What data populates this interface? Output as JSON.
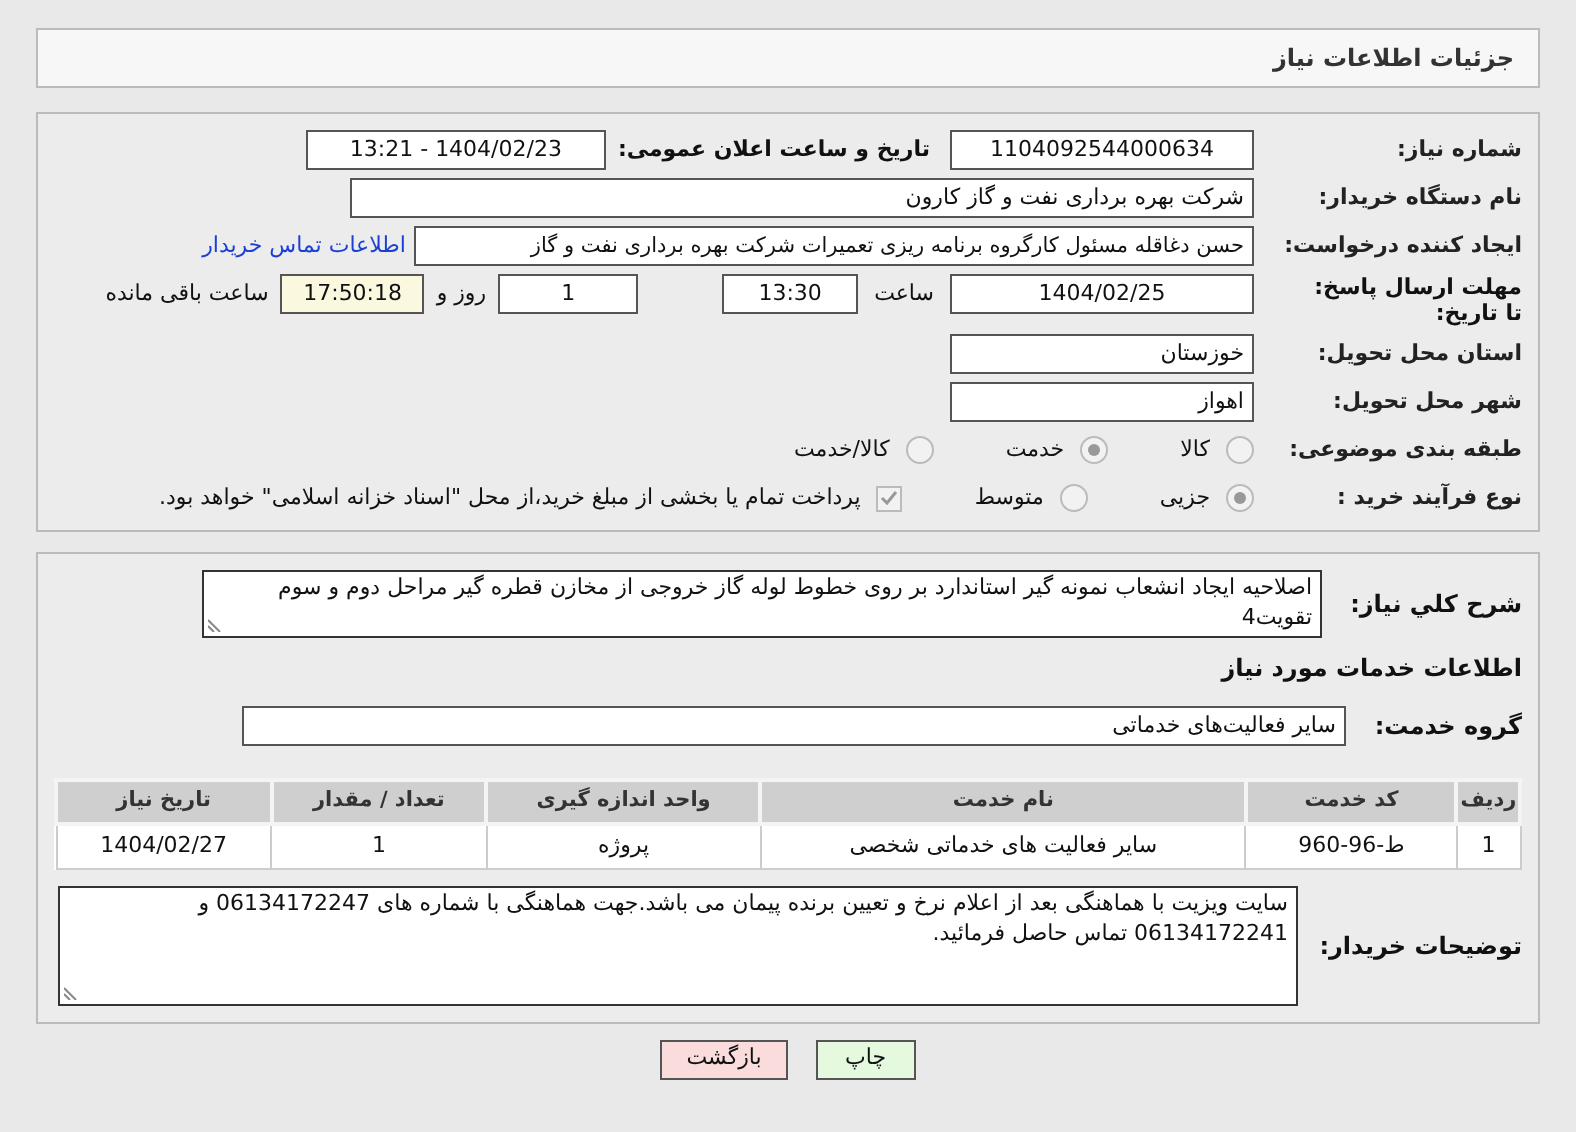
{
  "header": {
    "title": "جزئیات اطلاعات نیاز"
  },
  "need_number": {
    "label": "شماره نیاز:",
    "value": "1104092544000634"
  },
  "announce_datetime": {
    "label": "تاریخ و ساعت اعلان عمومی:",
    "value": "1404/02/23 - 13:21"
  },
  "buyer_org": {
    "label": "نام دستگاه خریدار:",
    "value": "شرکت بهره برداری نفت و گاز کارون"
  },
  "requester": {
    "label": "ایجاد کننده درخواست:",
    "value": "حسن دغاقله مسئول کارگروه برنامه ریزی تعمیرات شرکت بهره برداری نفت و گاز",
    "link": "اطلاعات تماس خریدار"
  },
  "deadline": {
    "label": "مهلت ارسال پاسخ: تا تاریخ:",
    "date": "1404/02/25",
    "time_label": "ساعت",
    "time": "13:30",
    "days": "1",
    "days_label": "روز و",
    "remaining": "17:50:18",
    "remaining_label": "ساعت باقی مانده"
  },
  "province": {
    "label": "استان محل تحویل:",
    "value": "خوزستان"
  },
  "city": {
    "label": "شهر محل تحویل:",
    "value": "اهواز"
  },
  "category": {
    "label": "طبقه بندی موضوعی:",
    "options": [
      {
        "label": "کالا",
        "selected": false
      },
      {
        "label": "خدمت",
        "selected": true
      },
      {
        "label": "کالا/خدمت",
        "selected": false
      }
    ]
  },
  "process": {
    "label": "نوع فرآیند خرید :",
    "options": [
      {
        "label": "جزیی",
        "selected": true
      },
      {
        "label": "متوسط",
        "selected": false
      }
    ],
    "payment": {
      "text": "پرداخت تمام یا بخشی از مبلغ خرید،از محل \"اسناد خزانه اسلامی\" خواهد بود.",
      "checked": true
    }
  },
  "description": {
    "label": "شرح کلي نیاز:",
    "value": "اصلاحیه ایجاد انشعاب نمونه گیر استاندارد بر روی خطوط لوله گاز خروجی از مخازن قطره گیر مراحل دوم و سوم تقویت4"
  },
  "services_title": "اطلاعات خدمات مورد نیاز",
  "service_group": {
    "label": "گروه خدمت:",
    "value": "سایر فعالیت‌های خدماتی"
  },
  "table": {
    "columns": [
      "ردیف",
      "کد خدمت",
      "نام خدمت",
      "واحد اندازه گیری",
      "تعداد / مقدار",
      "تاریخ نیاز"
    ],
    "rows": [
      [
        "1",
        "ط-96-960",
        "سایر فعالیت های خدماتی شخصی",
        "پروژه",
        "1",
        "1404/02/27"
      ]
    ]
  },
  "buyer_notes": {
    "label": "توضیحات خریدار:",
    "value": "سایت ویزیت با هماهنگی بعد از اعلام نرخ و تعیین برنده پیمان می باشد.جهت هماهنگی با شماره های  06134172247 و 06134172241 تماس حاصل فرمائید."
  },
  "buttons": [
    {
      "label": "چاپ",
      "kind": "print"
    },
    {
      "label": "بازگشت",
      "kind": "back"
    }
  ]
}
